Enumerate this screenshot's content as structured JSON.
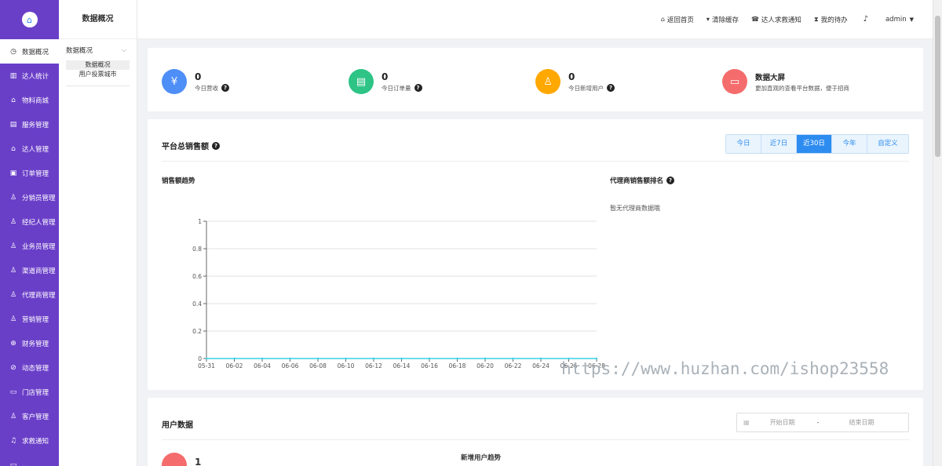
{
  "sidebar": {
    "items": [
      {
        "label": "数据概况",
        "icon": "◷",
        "active": true
      },
      {
        "label": "达人统计",
        "icon": "▥"
      },
      {
        "label": "物料商城",
        "icon": "⌂"
      },
      {
        "label": "服务管理",
        "icon": "▤"
      },
      {
        "label": "达人管理",
        "icon": "⌂"
      },
      {
        "label": "订单管理",
        "icon": "▣"
      },
      {
        "label": "分销员管理",
        "icon": "♙"
      },
      {
        "label": "经纪人管理",
        "icon": "♙"
      },
      {
        "label": "业务员管理",
        "icon": "♙"
      },
      {
        "label": "渠道商管理",
        "icon": "♙"
      },
      {
        "label": "代理商管理",
        "icon": "♙"
      },
      {
        "label": "营销管理",
        "icon": "♙"
      },
      {
        "label": "财务管理",
        "icon": "⊕"
      },
      {
        "label": "动态管理",
        "icon": "⊘"
      },
      {
        "label": "门店管理",
        "icon": "▭"
      },
      {
        "label": "客户管理",
        "icon": "♙"
      },
      {
        "label": "求救通知",
        "icon": "♫"
      },
      {
        "label": "…",
        "icon": "▭"
      }
    ]
  },
  "subnav": {
    "title": "数据概况",
    "group": "数据概况",
    "items": [
      "数据概况",
      "用户投票城市"
    ]
  },
  "header": {
    "links": [
      {
        "label": "返回首页",
        "icon": "home-icon",
        "glyph": "⌂"
      },
      {
        "label": "清除缓存",
        "icon": "pin-icon",
        "glyph": "▾"
      },
      {
        "label": "达人求救通知",
        "icon": "alarm-icon",
        "glyph": "☎"
      },
      {
        "label": "我的待办",
        "icon": "hourglass-icon",
        "glyph": "⧗"
      }
    ],
    "bell": "bell-icon",
    "user": "admin"
  },
  "stats": [
    {
      "value": "0",
      "label": "今日营收",
      "color": "#4e8ef7",
      "icon": "¥"
    },
    {
      "value": "0",
      "label": "今日订单量",
      "color": "#2ec486",
      "icon": "▤"
    },
    {
      "value": "0",
      "label": "今日新增用户",
      "color": "#ffa800",
      "icon": "♙"
    },
    {
      "value": "数据大屏",
      "label": "更加直观的查看平台数据，便于招商",
      "color": "#f56c6c",
      "icon": "▭"
    }
  ],
  "sales": {
    "title": "平台总销售额",
    "tabs": [
      "今日",
      "近7日",
      "近30日",
      "今年",
      "自定义"
    ],
    "active_tab": "近30日",
    "trend_title": "销售额趋势",
    "rank_title": "代理商销售额排名",
    "rank_empty": "暂无代理商数据哦"
  },
  "chart_data": {
    "type": "line",
    "x": [
      "05-31",
      "06-02",
      "06-04",
      "06-06",
      "06-08",
      "06-10",
      "06-12",
      "06-14",
      "06-16",
      "06-18",
      "06-20",
      "06-22",
      "06-24",
      "06-26",
      "06-28"
    ],
    "series": [
      {
        "values": [
          0,
          0,
          0,
          0,
          0,
          0,
          0,
          0,
          0,
          0,
          0,
          0,
          0,
          0,
          0
        ],
        "color": "#3ad0e4"
      }
    ],
    "yticks": [
      "0",
      "0.2",
      "0.4",
      "0.6",
      "0.8",
      "1"
    ],
    "ylim": [
      0,
      1
    ],
    "title": "",
    "grid": true
  },
  "users": {
    "title": "用户数据",
    "start_placeholder": "开始日期",
    "end_placeholder": "结束日期",
    "separator": "-",
    "count": "1",
    "trend_title": "新增用户趋势"
  },
  "watermark": "https://www.huzhan.com/ishop23558"
}
